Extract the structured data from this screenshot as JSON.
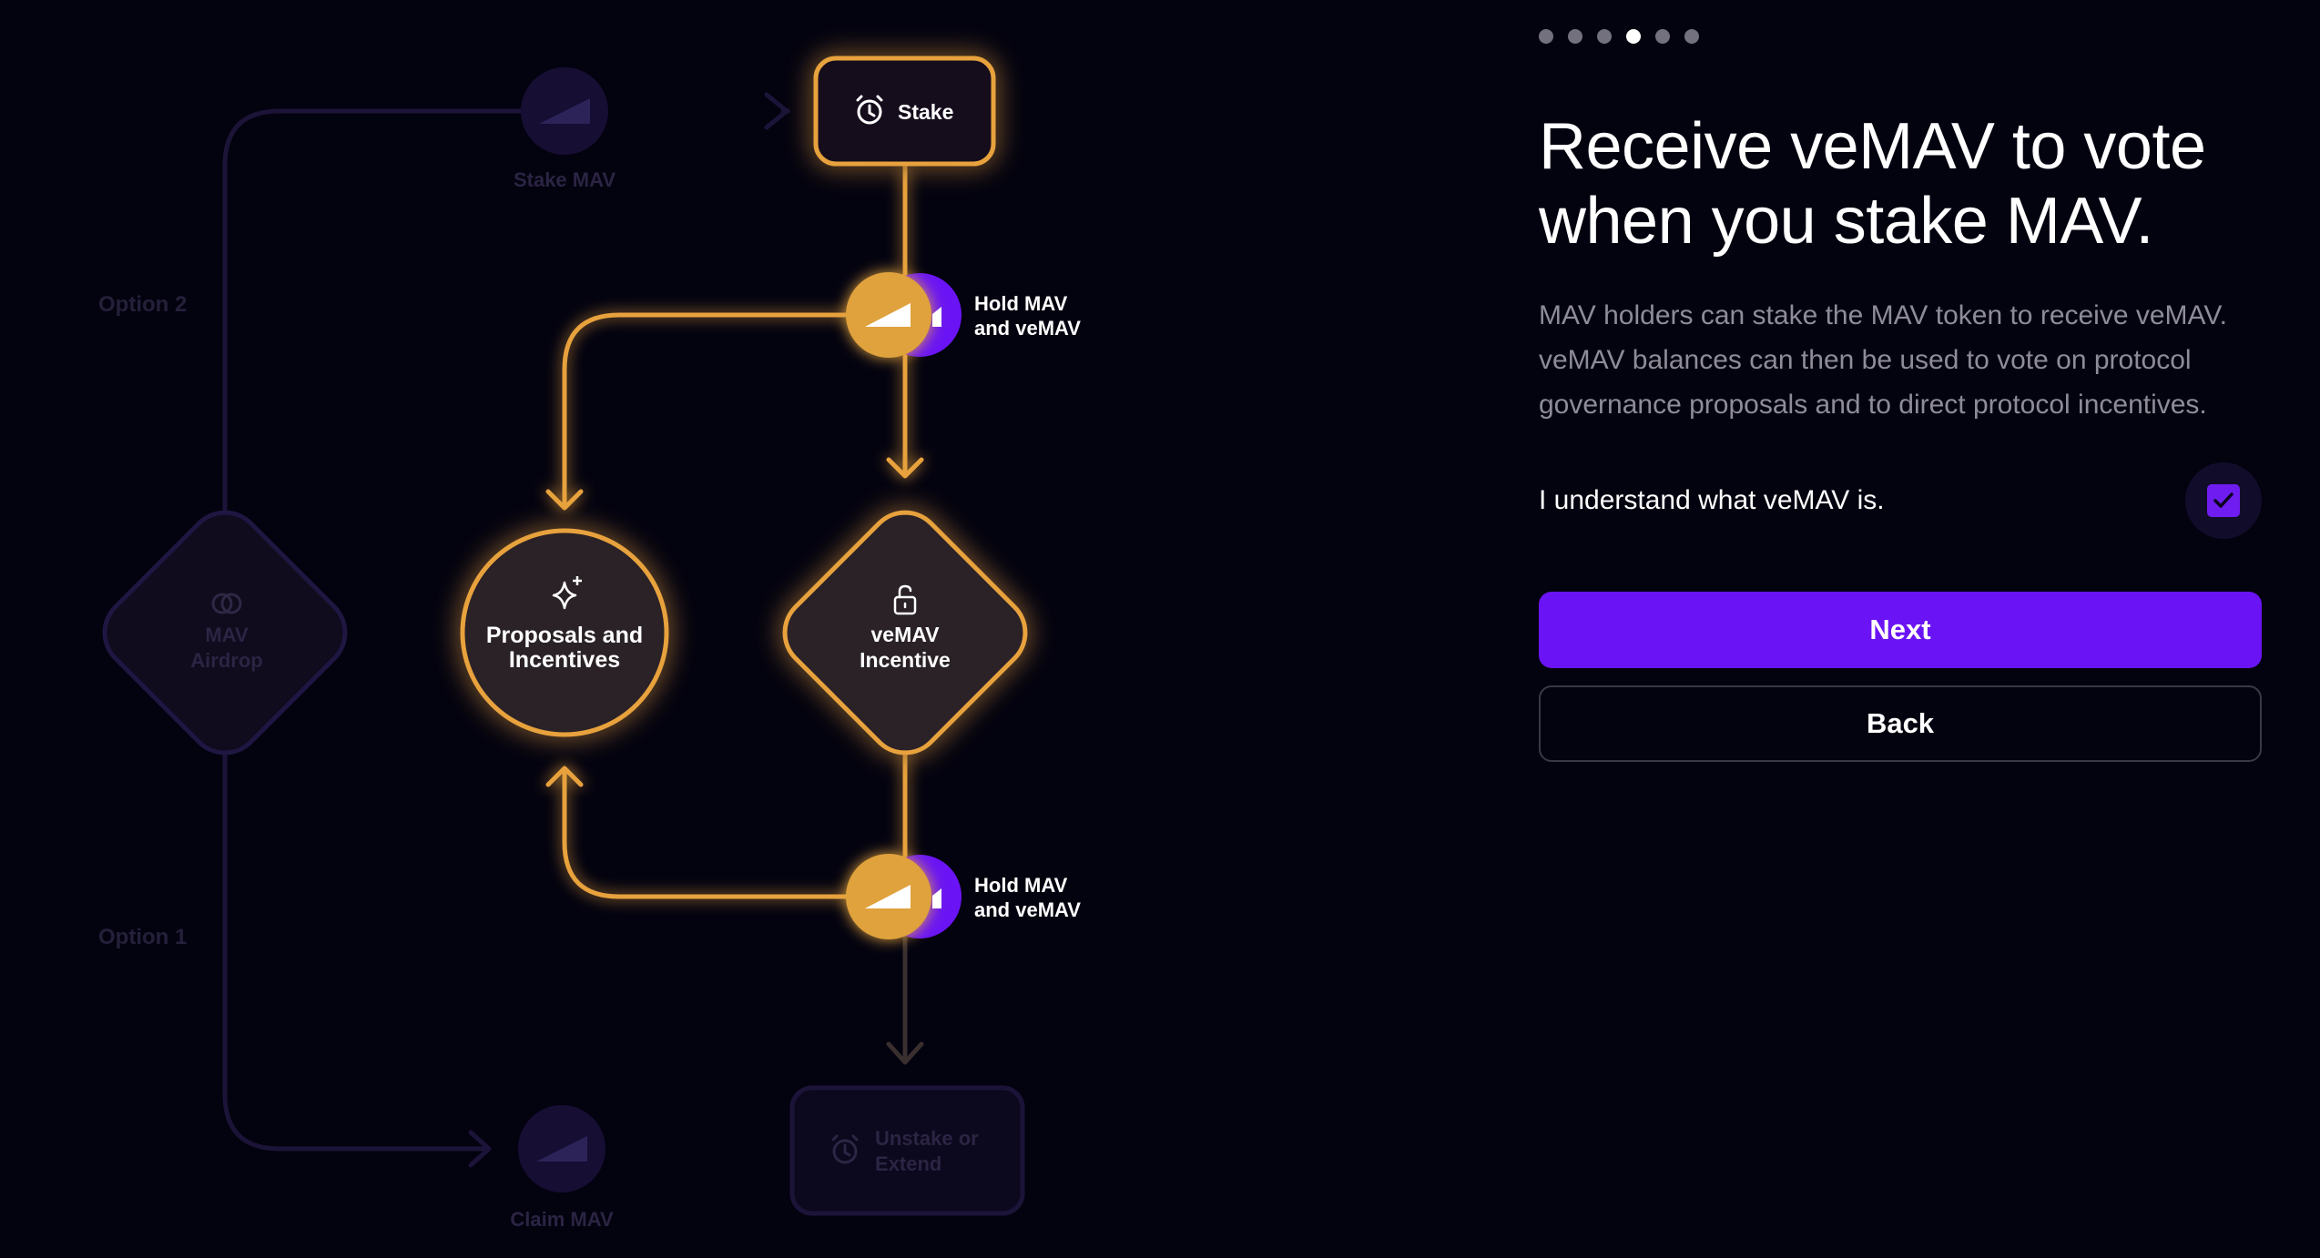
{
  "progress": {
    "total_steps": 6,
    "current_step": 4
  },
  "flow": {
    "stake_mav": "Stake MAV",
    "claim_mav": "Claim MAV",
    "option_2": "Option 2",
    "option_1": "Option 1",
    "airdrop_line1": "MAV",
    "airdrop_line2": "Airdrop",
    "stake": "Stake",
    "hold_top_line1": "Hold MAV",
    "hold_top_line2": "and veMAV",
    "hold_bottom_line1": "Hold MAV",
    "hold_bottom_line2": "and veMAV",
    "proposals_line1": "Proposals and",
    "proposals_line2": "Incentives",
    "vemav_line1": "veMAV",
    "vemav_line2": "Incentive",
    "unstake_line1": "Unstake or",
    "unstake_line2": "Extend"
  },
  "panel": {
    "title_line1": "Receive veMAV to vote",
    "title_line2": "when you stake MAV.",
    "desc_line1": "MAV holders can stake the MAV token to receive veMAV.",
    "desc_line2": "veMAV balances can then be used to vote on protocol",
    "desc_line3": "governance proposals and to direct protocol incentives.",
    "ack_label": "I understand what veMAV is.",
    "ack_checked": true,
    "next_label": "Next",
    "back_label": "Back"
  },
  "colors": {
    "background": "#03020f",
    "accent_orange": "#e8a23d",
    "accent_purple": "#6a14f5",
    "dim_purple": "#1b1240",
    "node_fill": "#2a2228"
  },
  "icons": {
    "stake": "alarm-clock-icon",
    "proposals": "sparkle-icon",
    "vemav": "unlock-icon",
    "airdrop": "coins-icon",
    "mav_token": "mav-logo-icon",
    "unstake": "alarm-clock-icon",
    "ack": "check-icon"
  }
}
